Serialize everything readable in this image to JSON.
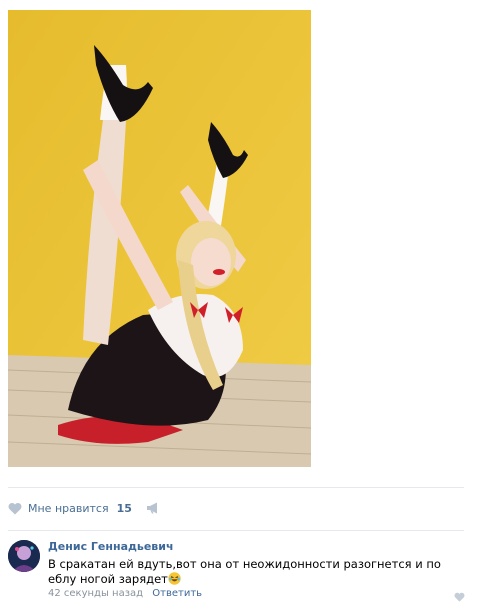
{
  "post": {
    "photo_alt": "",
    "likes": {
      "label": "Мне нравится",
      "count": "15"
    }
  },
  "icons": {
    "like": "heart-icon",
    "share": "megaphone-icon",
    "comment_like": "heart-icon"
  },
  "colors": {
    "link": "#3d6898",
    "meta": "#8a929c",
    "photo_background": "#e9c036",
    "divider": "#e7e8ec"
  },
  "comment": {
    "author": "Денис Геннадьевич",
    "text": "В сракатан ей вдуть,вот она от неожидонности разогнется и по еблу ногой зарядет",
    "emoji": "laughing-face",
    "time": "42 секунды назад",
    "reply_label": "Ответить"
  }
}
